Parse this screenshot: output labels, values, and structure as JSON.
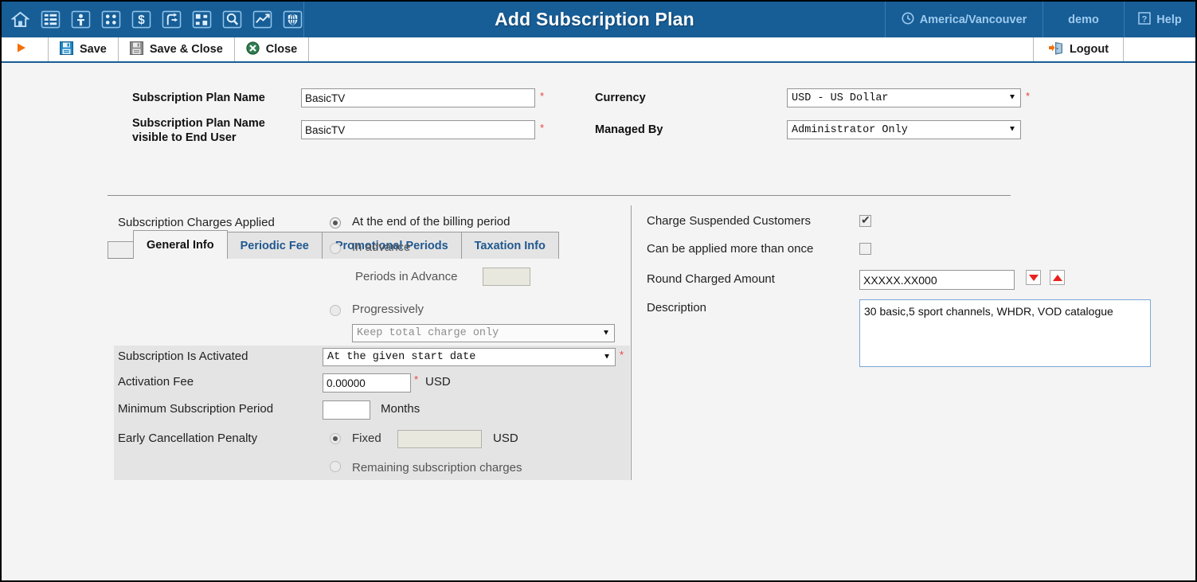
{
  "header": {
    "title": "Add Subscription Plan",
    "timezone": "America/Vancouver",
    "user": "demo",
    "help": "Help",
    "nav_icons": [
      {
        "name": "home-icon"
      },
      {
        "name": "list-icon"
      },
      {
        "name": "person-icon"
      },
      {
        "name": "services-icon"
      },
      {
        "name": "dollar-icon"
      },
      {
        "name": "routing-icon"
      },
      {
        "name": "nodes-icon"
      },
      {
        "name": "search-icon"
      },
      {
        "name": "chart-icon"
      },
      {
        "name": "globe-shield-icon"
      }
    ]
  },
  "toolbar": {
    "run_label": "",
    "save_label": "Save",
    "save_close_label": "Save & Close",
    "close_label": "Close",
    "logout_label": "Logout"
  },
  "form": {
    "plan_name_label": "Subscription Plan Name",
    "plan_name_value": "BasicTV",
    "plan_name_enduser_label_line1": "Subscription Plan Name",
    "plan_name_enduser_label_line2": "visible to End User",
    "plan_name_enduser_value": "BasicTV",
    "currency_label": "Currency",
    "currency_value": "USD - US Dollar",
    "managed_by_label": "Managed By",
    "managed_by_value": "Administrator Only",
    "required_marker": "*"
  },
  "tabs": [
    {
      "label": "General Info",
      "active": true
    },
    {
      "label": "Periodic Fee",
      "active": false
    },
    {
      "label": "Promotional Periods",
      "active": false
    },
    {
      "label": "Taxation Info",
      "active": false
    }
  ],
  "general_info": {
    "charges_applied_label": "Subscription Charges Applied",
    "option_end_of_billing": "At the end of the billing period",
    "option_in_advance": "In advance",
    "periods_in_advance_label": "Periods in Advance",
    "periods_in_advance_value": "",
    "option_progressively": "Progressively",
    "progressive_mode_value": "Keep total charge only",
    "activated_label": "Subscription Is Activated",
    "activated_value": "At the given start date",
    "activation_fee_label": "Activation Fee",
    "activation_fee_value": "0.00000",
    "activation_fee_currency": "USD",
    "min_period_label": "Minimum Subscription Period",
    "min_period_value": "",
    "min_period_unit": "Months",
    "penalty_label": "Early Cancellation Penalty",
    "penalty_fixed_label": "Fixed",
    "penalty_fixed_value": "",
    "penalty_fixed_currency": "USD",
    "penalty_remaining_label": "Remaining subscription charges"
  },
  "right_panel": {
    "charge_suspended_label": "Charge Suspended Customers",
    "charge_suspended_checked": true,
    "applied_more_than_once_label": "Can be applied more than once",
    "applied_more_than_once_checked": false,
    "round_amount_label": "Round Charged Amount",
    "round_amount_value": "XXXXX.XX000",
    "description_label": "Description",
    "description_value": "30 basic,5 sport channels, WHDR, VOD catalogue"
  },
  "colors": {
    "header_blue": "#175d96",
    "link_blue": "#20588f",
    "required_red": "#e8433a",
    "panel_gray": "#e4e4e4",
    "page_bg": "#f4f4f4"
  }
}
